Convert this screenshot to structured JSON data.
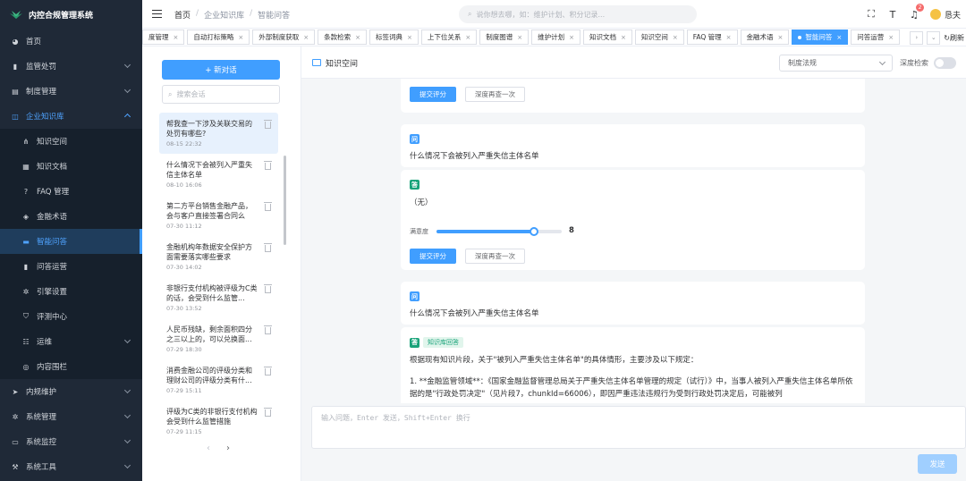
{
  "app": {
    "title": "内控合规管理系统"
  },
  "sidebar": {
    "items": [
      {
        "label": "首页",
        "icon": "dashboard-icon"
      },
      {
        "label": "监管处罚",
        "icon": "bar-chart-icon"
      },
      {
        "label": "制度管理",
        "icon": "document-icon"
      },
      {
        "label": "企业知识库",
        "icon": "book-icon"
      },
      {
        "label": "知识空间",
        "icon": "tree-icon"
      },
      {
        "label": "知识文档",
        "icon": "file-icon"
      },
      {
        "label": "FAQ 管理",
        "icon": "question-icon"
      },
      {
        "label": "金融术语",
        "icon": "term-icon"
      },
      {
        "label": "智能问答",
        "icon": "chat-icon"
      },
      {
        "label": "问答运营",
        "icon": "chart-icon"
      },
      {
        "label": "引擎设置",
        "icon": "gear-icon"
      },
      {
        "label": "评测中心",
        "icon": "shield-icon"
      },
      {
        "label": "运维",
        "icon": "ops-icon"
      },
      {
        "label": "内容围栏",
        "icon": "fence-icon"
      },
      {
        "label": "内规维护",
        "icon": "nav-icon"
      },
      {
        "label": "系统管理",
        "icon": "gear-icon"
      },
      {
        "label": "系统监控",
        "icon": "monitor-icon"
      },
      {
        "label": "系统工具",
        "icon": "tool-icon"
      }
    ]
  },
  "header": {
    "breadcrumb": [
      "首页",
      "企业知识库",
      "智能问答"
    ],
    "search_placeholder": "说你想去哪，如：维护计划、积分记录...",
    "notification_count": "2",
    "user_name": "恳夫"
  },
  "tabs": {
    "items": [
      "度管理",
      "自动打标策略",
      "外部制度获取",
      "条款检索",
      "标签词典",
      "上下位关系",
      "制度图谱",
      "维护计划",
      "知识文档",
      "知识空间",
      "FAQ 管理",
      "金融术语",
      "智能问答",
      "问答运营"
    ],
    "active_index": 12,
    "refresh_label": "刷新"
  },
  "conversations": {
    "new_chat_label": "+ 新对话",
    "search_placeholder": "搜索会话",
    "items": [
      {
        "title": "帮我查一下涉及关联交易的处罚有哪些?",
        "date": "08-15 22:32"
      },
      {
        "title": "什么情况下会被列入严重失信主体名单",
        "date": "08-10 16:06"
      },
      {
        "title": "第二方平台销售金融产品，会与客户直接签署合同么",
        "date": "07-30 11:12"
      },
      {
        "title": "金融机构年数据安全保护方面需要落实哪些要求",
        "date": "07-30 14:02"
      },
      {
        "title": "非银行支付机构被评级为C类的话，会受到什么监管...",
        "date": "07-30 13:52"
      },
      {
        "title": "人民币残缺，剩余面积四分之三以上的，可以兑换面...",
        "date": "07-29 18:30"
      },
      {
        "title": "消费金融公司的评级分类和理财公司的评级分类有什...",
        "date": "07-29 15:11"
      },
      {
        "title": "评级为C类的非银行支付机构会受到什么监管措施",
        "date": "07-29 11:15"
      }
    ],
    "selected_index": 0,
    "pager_prev": "‹",
    "pager_next": "›"
  },
  "main": {
    "title": "知识空间",
    "kb_select_value": "制度法规",
    "deep_search_label": "深度检索",
    "deep_search_on": false,
    "submit_label": "提交评分",
    "deep_again_label": "深度再查一次",
    "q_badge": "问",
    "a_badge": "答",
    "cards": [
      {
        "question": "什么情况下会被列入严重失信主体名单",
        "answer": "（无）",
        "satisfaction_label": "满意度",
        "satisfaction_value": "8",
        "satisfaction_fraction": 0.78
      },
      {
        "question": "什么情况下会被列入严重失信主体名单",
        "answer_source_tag": "知识库回答",
        "answer_intro": "根据现有知识片段，关于\"被列入严重失信主体名单\"的具体情形，主要涉及以下规定：",
        "answer_body": "1. **金融监管领域**：《国家金融监督管理总局关于严重失信主体名单管理的规定（试行）》中，当事人被列入严重失信主体名单所依据的是\"行政处罚决定\"（见片段7，chunkId=66006），即因严重违法违规行为受到行政处罚决定后，可能被列"
      }
    ],
    "input_placeholder": "输入问题，Enter 发送，Shift+Enter 换行",
    "send_label": "发送"
  },
  "colors": {
    "primary": "#409eff",
    "sidebar_bg": "#1f2937",
    "answer_green": "#1aa37a"
  }
}
